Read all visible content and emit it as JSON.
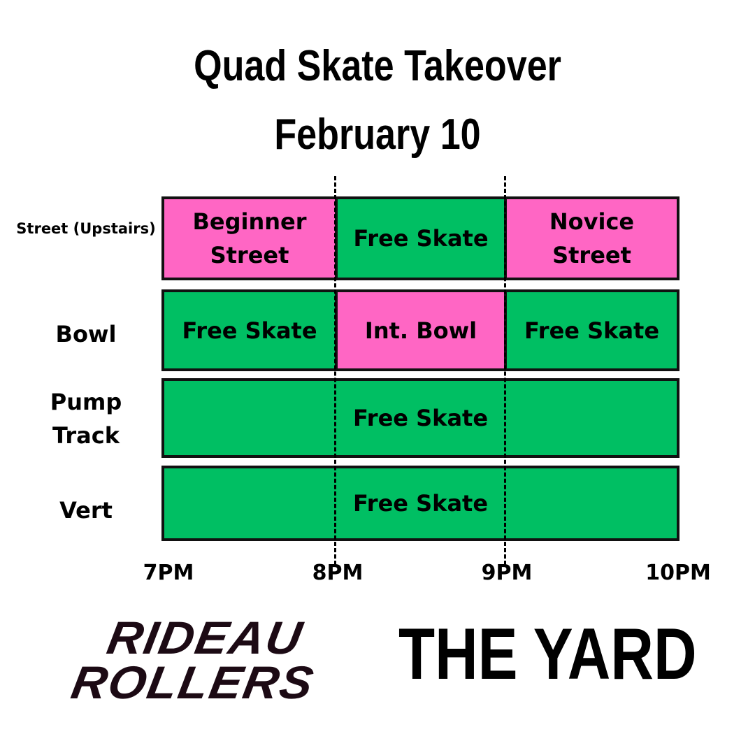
{
  "title": {
    "line1": "Quad Skate Takeover",
    "line2": "February 10"
  },
  "rows": [
    {
      "label": "Street (Upstairs)"
    },
    {
      "label": "Bowl"
    },
    {
      "label": "Pump Track"
    },
    {
      "label": "Vert"
    }
  ],
  "cells": {
    "street": [
      "Beginner Street",
      "Free Skate",
      "Novice Street"
    ],
    "bowl": [
      "Free Skate",
      "Int. Bowl",
      "Free Skate"
    ],
    "pump": "Free Skate",
    "vert": "Free Skate"
  },
  "colors": {
    "session": "#ff66c4",
    "free_skate": "#00bf63",
    "border": "#111111"
  },
  "times": [
    "7PM",
    "8PM",
    "9PM",
    "10PM"
  ],
  "logos": {
    "rideau_line1": "RIDEAU",
    "rideau_line2": "ROLLERS",
    "yard": "THE YARD"
  }
}
